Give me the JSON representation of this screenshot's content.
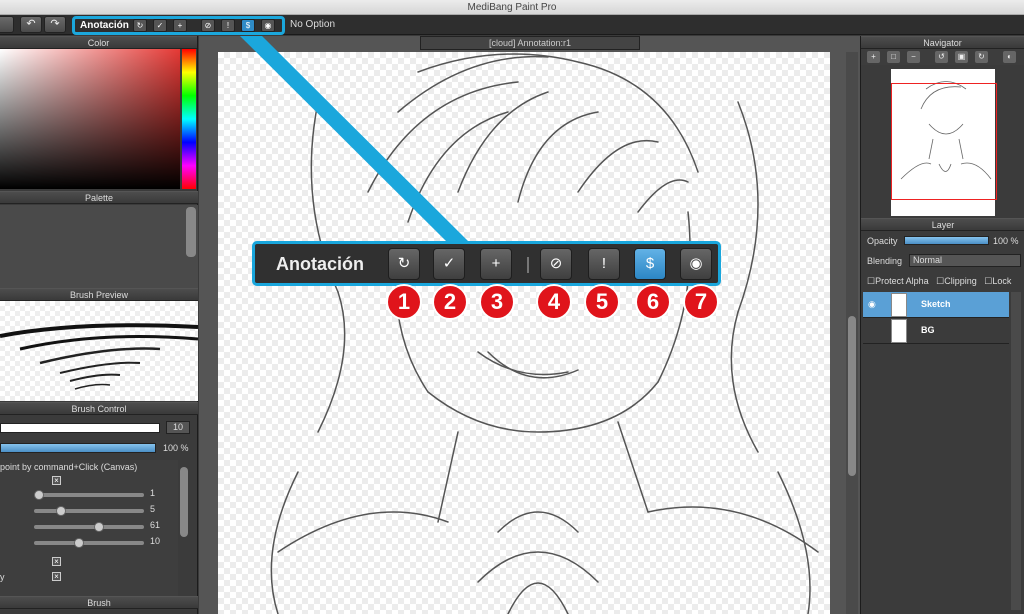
{
  "window": {
    "title": "MediBang Paint Pro"
  },
  "toolbar": {
    "annotation_label": "Anotación",
    "no_option": "No Option",
    "buttons": [
      {
        "icon": "refresh-annotation-icon",
        "glyph": "↻"
      },
      {
        "icon": "check-annotation-icon",
        "glyph": "✓"
      },
      {
        "icon": "add-annotation-icon",
        "glyph": "+"
      },
      {
        "icon": "hide-annotation-icon",
        "glyph": "⊘"
      },
      {
        "icon": "alert-annotation-icon",
        "glyph": "!"
      },
      {
        "icon": "annotation-mode-icon",
        "glyph": "$",
        "active": true
      },
      {
        "icon": "show-annotation-icon",
        "glyph": "◉"
      }
    ]
  },
  "left_panel": {
    "color_title": "Color",
    "palette_title": "Palette",
    "brush_preview_title": "Brush Preview",
    "brush_control_title": "Brush Control",
    "size_value": "10",
    "opacity_value": "100 %",
    "command_hint": "point by command+Click (Canvas)",
    "slider_values": [
      "1",
      "5",
      "61",
      "10"
    ],
    "bottom_label": "y",
    "brush_title": "Brush"
  },
  "canvas": {
    "tab_title": "[cloud] Annotation:r1"
  },
  "navigator": {
    "title": "Navigator"
  },
  "layer": {
    "title": "Layer",
    "opacity_label": "Opacity",
    "opacity_value": "100 %",
    "opacity_level": 1.0,
    "blending_label": "Blending",
    "blending_value": "Normal",
    "protect_alpha": "Protect Alpha",
    "clipping": "Clipping",
    "lock": "Lock",
    "layers": [
      {
        "name": "Sketch",
        "selected": true
      },
      {
        "name": "BG",
        "selected": false
      }
    ]
  },
  "callout": {
    "label": "Anotación",
    "badges": [
      "1",
      "2",
      "3",
      "4",
      "5",
      "6",
      "7"
    ]
  },
  "colors": {
    "accent": "#1ba7dc",
    "badge_red": "#e0141b",
    "selected_layer": "#5aa0d6"
  }
}
